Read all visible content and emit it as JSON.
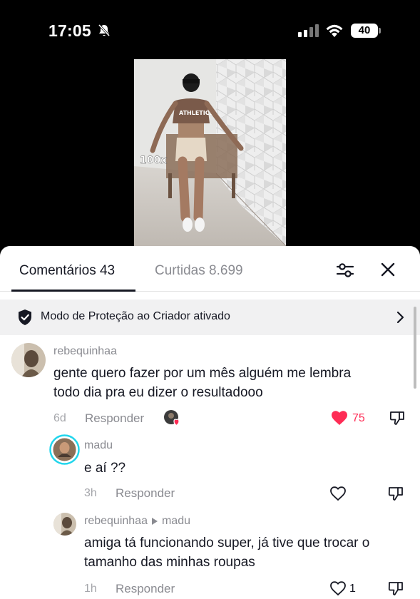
{
  "status_bar": {
    "time": "17:05",
    "battery": "40"
  },
  "video": {
    "overlay_text": "100x"
  },
  "tabs": {
    "comments": "Comentários 43",
    "likes": "Curtidas 8.699"
  },
  "banner": {
    "text": "Modo de Proteção ao Criador ativado"
  },
  "comments": [
    {
      "username": "rebequinhaa",
      "text_line1": "gente quero fazer por um mês alguém me lembra",
      "text_line2": "todo dia pra eu dizer o resultadooo",
      "time": "6d",
      "reply_label": "Responder",
      "likes": "75",
      "liked": true,
      "creator_liked": true
    },
    {
      "username": "madu",
      "text": "e aí ??",
      "time": "3h",
      "reply_label": "Responder",
      "likes": ""
    },
    {
      "username": "rebequinhaa",
      "reply_to": "madu",
      "text_line1": "amiga tá funcionando super, já tive que trocar o",
      "text_line2": "tamanho das minhas roupas",
      "time": "1h",
      "reply_label": "Responder",
      "likes": "1"
    }
  ],
  "colors": {
    "like_red": "#fe2c55",
    "text_primary": "#161823",
    "text_secondary": "#8a8b91",
    "story_ring": "#20d5ec"
  },
  "icons": [
    "bell-slash-icon",
    "signal-icon",
    "wifi-icon",
    "battery-icon",
    "filter-icon",
    "close-icon",
    "shield-check-icon",
    "chevron-right-icon",
    "heart-icon",
    "dislike-icon"
  ]
}
